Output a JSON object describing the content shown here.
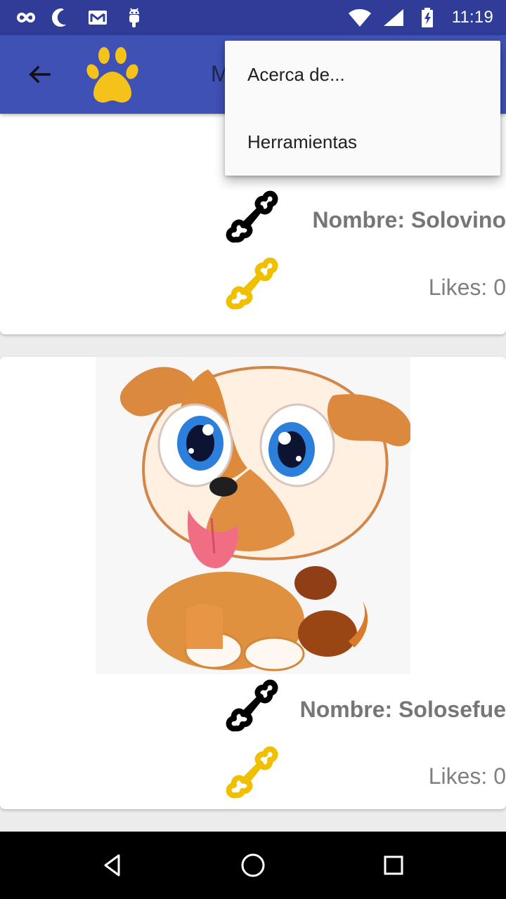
{
  "status_bar": {
    "time": "11:19",
    "left_icons": [
      "infinity-icon",
      "moon-icon",
      "mail-icon",
      "android-icon"
    ],
    "right_icons": [
      "wifi-icon",
      "signal-icon",
      "battery-icon"
    ]
  },
  "app_bar": {
    "back_icon": "arrow-left-icon",
    "logo_icon": "paw-icon",
    "title": "M",
    "background_color": "#3f51b5"
  },
  "menu": {
    "items": [
      "Acerca de...",
      "Herramientas"
    ]
  },
  "pets": [
    {
      "name": "Nombre: Solovino",
      "likes": "Likes: 0",
      "name_icon": "bone-icon",
      "likes_icon": "bone-gold-icon"
    },
    {
      "name": "Nombre: Solosefue",
      "likes": "Likes: 0",
      "image": "puppy-image",
      "name_icon": "bone-icon",
      "likes_icon": "bone-gold-icon"
    }
  ],
  "nav_bar": {
    "icons": [
      "triangle-back-icon",
      "circle-home-icon",
      "square-recents-icon"
    ]
  }
}
